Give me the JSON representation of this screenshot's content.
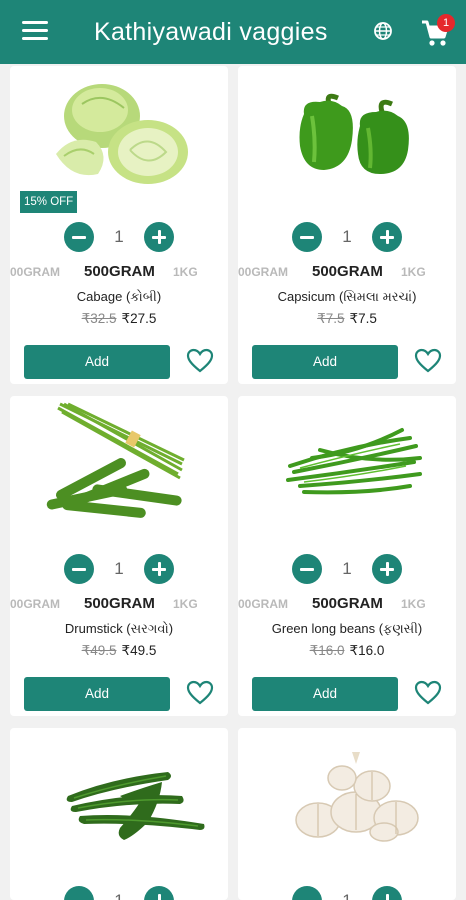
{
  "app_bar": {
    "title": "Kathiyawadi vaggies",
    "menu_icon": "hamburger-menu-icon",
    "language_icon": "globe-icon",
    "cart_icon": "shopping-cart-icon",
    "cart_count": "1"
  },
  "colors": {
    "primary": "#1e8577",
    "badge": "#e5282c",
    "heart": "#1e8577"
  },
  "products": [
    {
      "image": "cabbage",
      "discount": "15% OFF",
      "qty": "1",
      "sizes": [
        "00GRAM",
        "500GRAM",
        "1KG"
      ],
      "name": "Cabage (કોબી)",
      "old_price": "₹32.5",
      "price": "₹27.5",
      "add_label": "Add"
    },
    {
      "image": "capsicum",
      "discount": "",
      "qty": "1",
      "sizes": [
        "00GRAM",
        "500GRAM",
        "1KG"
      ],
      "name": "Capsicum (સિમલા મરચાં)",
      "old_price": "₹7.5",
      "price": "₹7.5",
      "add_label": "Add"
    },
    {
      "image": "drumstick",
      "discount": "",
      "qty": "1",
      "sizes": [
        "00GRAM",
        "500GRAM",
        "1KG"
      ],
      "name": "Drumstick (સરગવો)",
      "old_price": "₹49.5",
      "price": "₹49.5",
      "add_label": "Add"
    },
    {
      "image": "green-long-beans",
      "discount": "",
      "qty": "1",
      "sizes": [
        "00GRAM",
        "500GRAM",
        "1KG"
      ],
      "name": "Green long beans (ફણસી)",
      "old_price": "₹16.0",
      "price": "₹16.0",
      "add_label": "Add"
    },
    {
      "image": "ridge-gourd",
      "discount": "",
      "qty": "1",
      "sizes": [],
      "name": "",
      "old_price": "",
      "price": "",
      "add_label": ""
    },
    {
      "image": "garlic",
      "discount": "",
      "qty": "1",
      "sizes": [],
      "name": "",
      "old_price": "",
      "price": "",
      "add_label": ""
    }
  ]
}
